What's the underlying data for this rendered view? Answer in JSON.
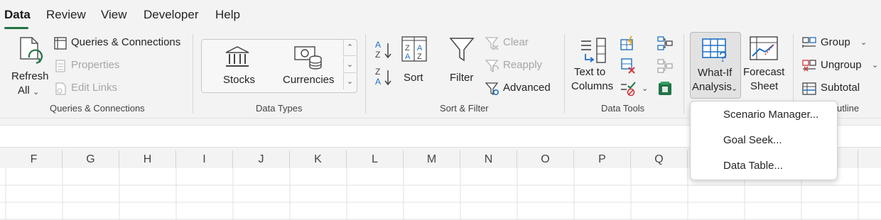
{
  "tabs": [
    {
      "label": "Data",
      "active": true
    },
    {
      "label": "Review"
    },
    {
      "label": "View"
    },
    {
      "label": "Developer"
    },
    {
      "label": "Help"
    }
  ],
  "queries": {
    "refresh_line1": "Refresh",
    "refresh_line2": "All",
    "queries_connections": "Queries & Connections",
    "properties": "Properties",
    "edit_links": "Edit Links",
    "group_label": "Queries & Connections"
  },
  "data_types": {
    "stocks": "Stocks",
    "currencies": "Currencies",
    "group_label": "Data Types"
  },
  "sort_filter": {
    "sort": "Sort",
    "filter": "Filter",
    "clear": "Clear",
    "reapply": "Reapply",
    "advanced": "Advanced",
    "group_label": "Sort & Filter"
  },
  "data_tools": {
    "text_to_columns_1": "Text to",
    "text_to_columns_2": "Columns",
    "group_label": "Data Tools"
  },
  "forecast": {
    "whatif_1": "What-If",
    "whatif_2": "Analysis",
    "forecast_1": "Forecast",
    "forecast_2": "Sheet"
  },
  "outline": {
    "group": "Group",
    "ungroup": "Ungroup",
    "subtotal": "Subtotal",
    "group_label_partial": "utline"
  },
  "whatif_menu": {
    "scenario_manager": "Scenario Manager...",
    "goal_seek": "Goal Seek...",
    "data_table": "Data Table..."
  },
  "columns": [
    "F",
    "G",
    "H",
    "I",
    "J",
    "K",
    "L",
    "M",
    "N",
    "O",
    "P",
    "Q"
  ],
  "colors": {
    "accent": "#217346",
    "blue_icon": "#1f6fc5",
    "disabled": "#a6a6a6"
  }
}
